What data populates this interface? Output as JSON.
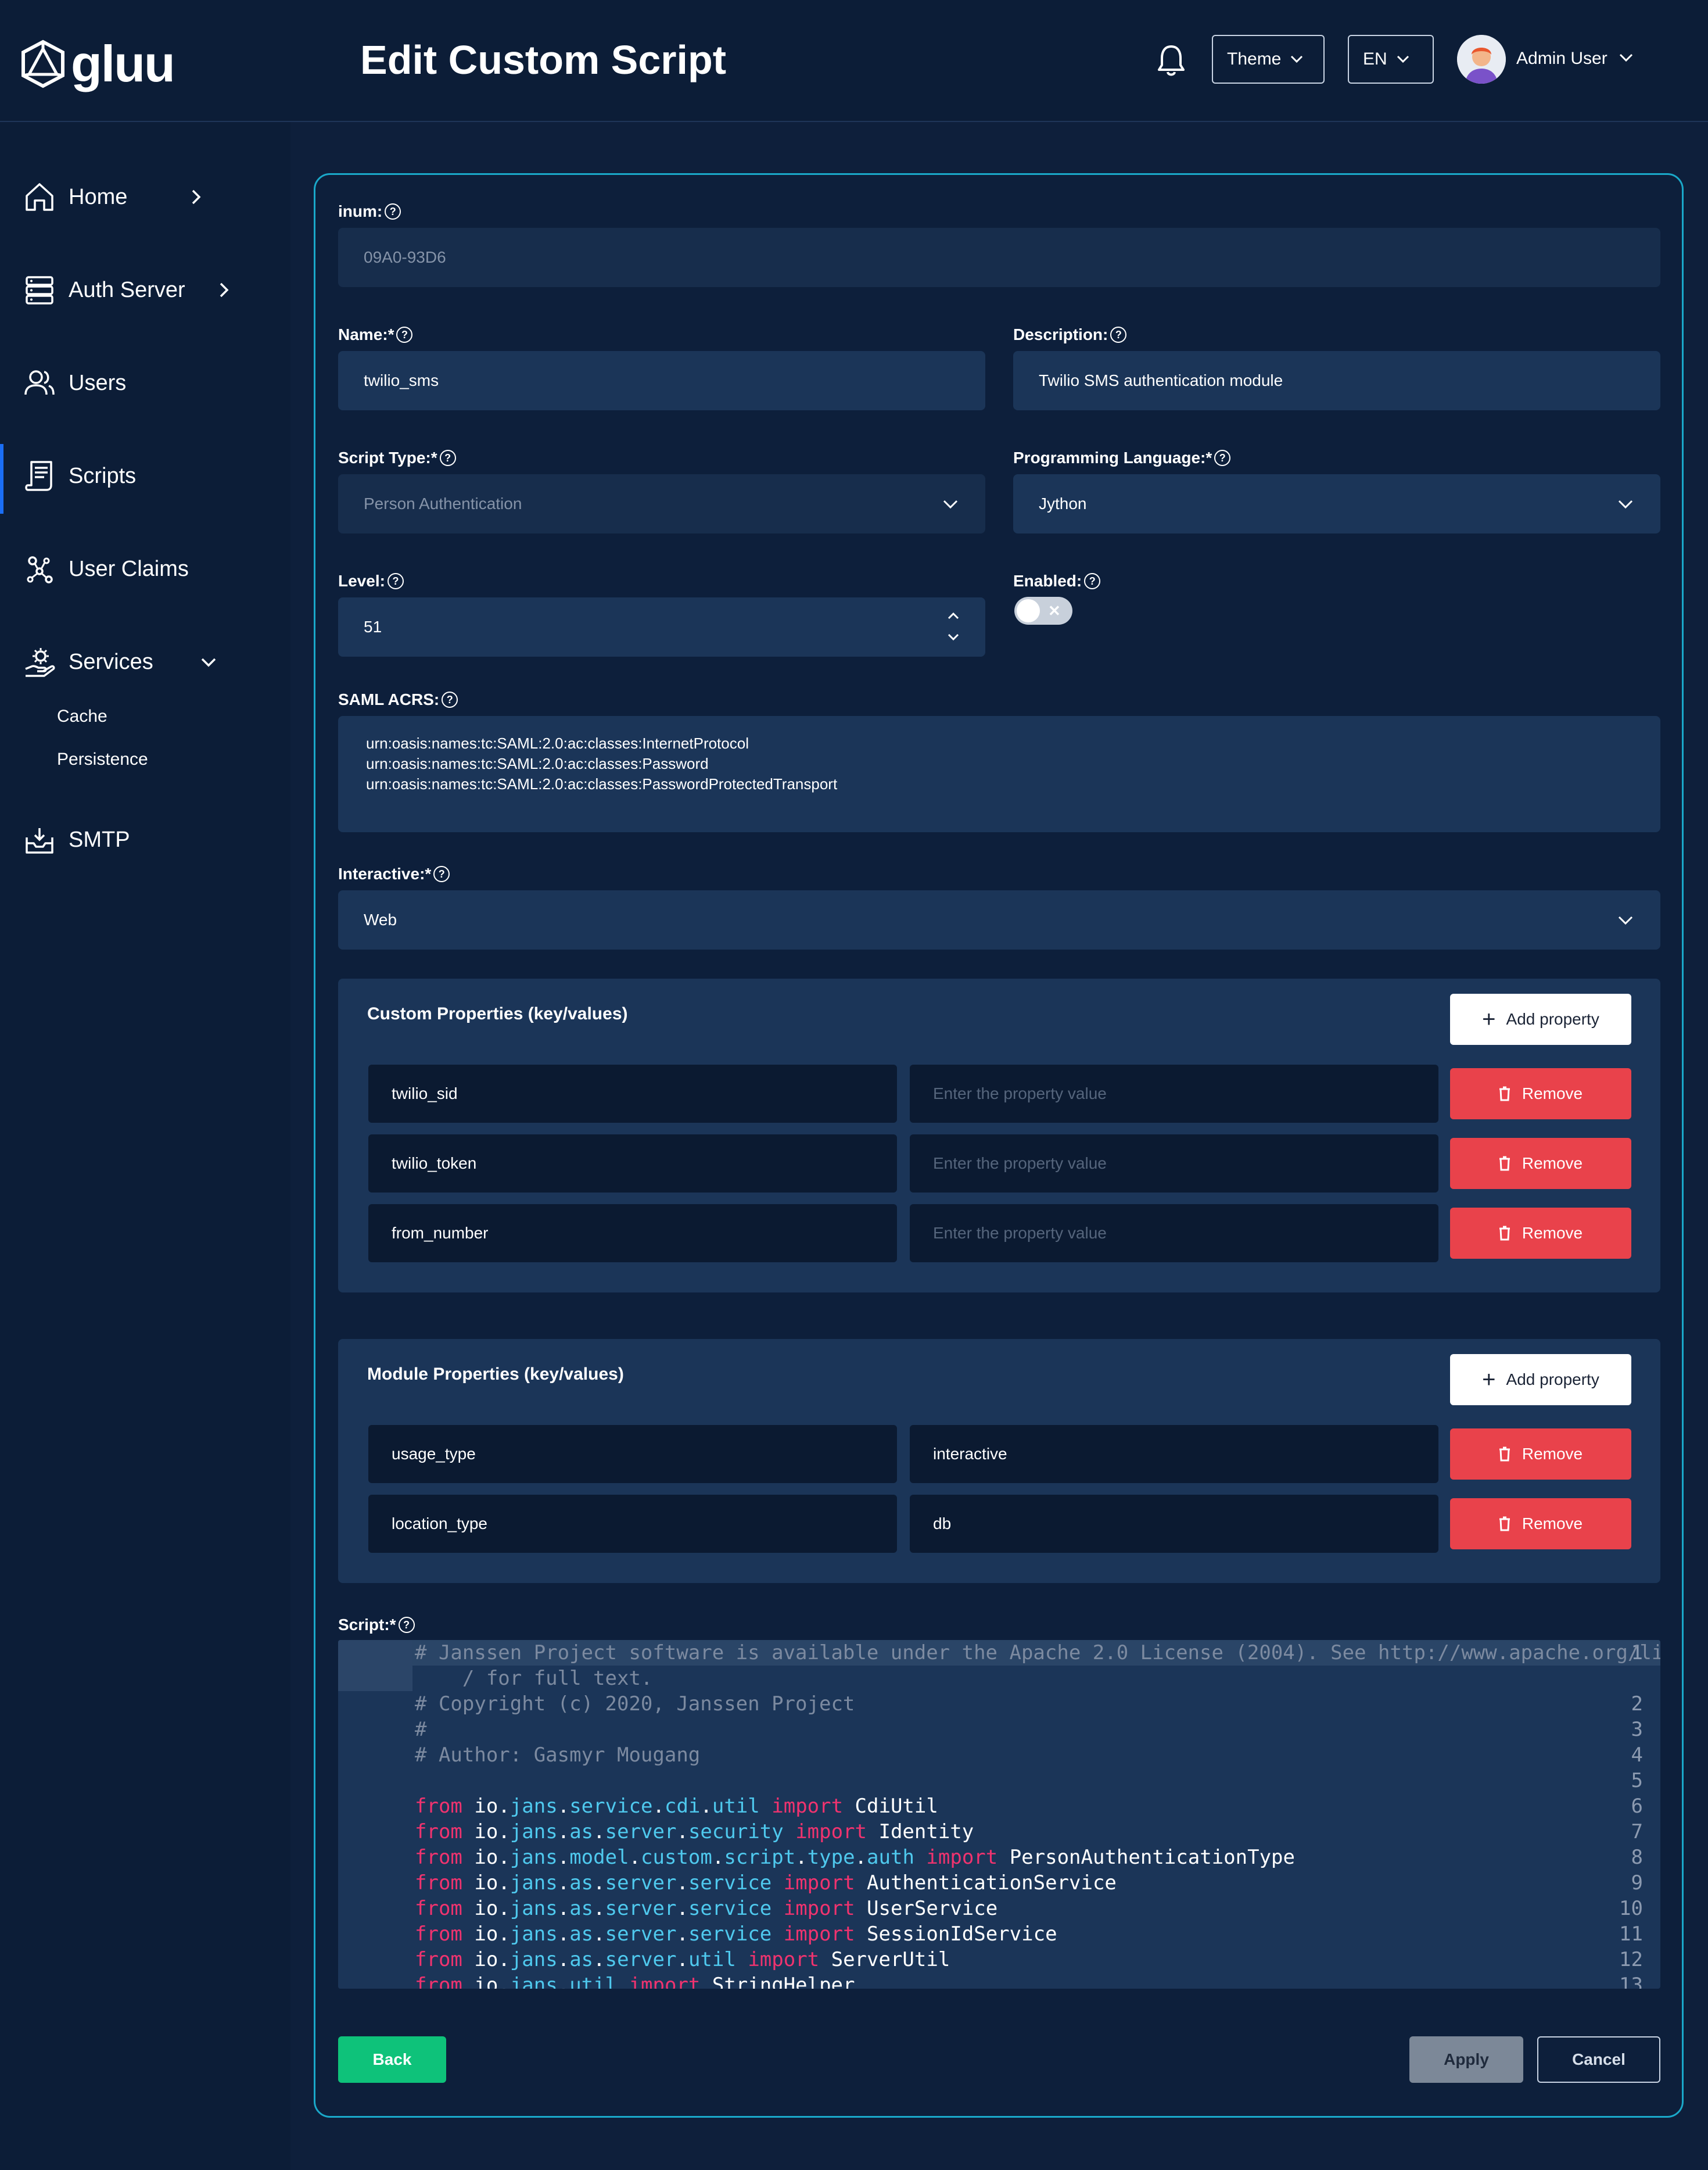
{
  "brand": {
    "name": "gluu"
  },
  "header": {
    "title": "Edit Custom Script",
    "theme_label": "Theme",
    "language_label": "EN",
    "user_name": "Admin User"
  },
  "sidebar": {
    "items": [
      {
        "label": "Home",
        "icon": "home-icon"
      },
      {
        "label": "Auth Server",
        "icon": "server-icon"
      },
      {
        "label": "Users",
        "icon": "users-icon"
      },
      {
        "label": "Scripts",
        "icon": "script-icon"
      },
      {
        "label": "User Claims",
        "icon": "claims-icon"
      },
      {
        "label": "Services",
        "icon": "services-icon",
        "subitems": [
          "Cache",
          "Persistence"
        ]
      },
      {
        "label": "SMTP",
        "icon": "mail-inbox-icon"
      }
    ]
  },
  "form": {
    "inum": {
      "label": "inum:",
      "value": "09A0-93D6"
    },
    "name": {
      "label": "Name:*",
      "value": "twilio_sms"
    },
    "description": {
      "label": "Description:",
      "value": "Twilio SMS authentication module"
    },
    "script_type": {
      "label": "Script Type:*",
      "value": "Person Authentication"
    },
    "programming_language": {
      "label": "Programming Language:*",
      "value": "Jython"
    },
    "level": {
      "label": "Level:",
      "value": "51"
    },
    "enabled": {
      "label": "Enabled:",
      "value": false
    },
    "saml_acrs": {
      "label": "SAML ACRS:",
      "values": [
        "urn:oasis:names:tc:SAML:2.0:ac:classes:InternetProtocol",
        "urn:oasis:names:tc:SAML:2.0:ac:classes:Password",
        "urn:oasis:names:tc:SAML:2.0:ac:classes:PasswordProtectedTransport"
      ]
    },
    "interactive": {
      "label": "Interactive:*",
      "value": "Web"
    }
  },
  "custom_properties": {
    "title": "Custom Properties (key/values)",
    "add_label": "Add property",
    "value_placeholder": "Enter the property value",
    "rows": [
      {
        "key": "twilio_sid",
        "value": ""
      },
      {
        "key": "twilio_token",
        "value": ""
      },
      {
        "key": "from_number",
        "value": ""
      }
    ],
    "remove_label": "Remove"
  },
  "module_properties": {
    "title": "Module Properties (key/values)",
    "add_label": "Add property",
    "rows": [
      {
        "key": "usage_type",
        "value": "interactive"
      },
      {
        "key": "location_type",
        "value": "db"
      }
    ],
    "remove_label": "Remove"
  },
  "script": {
    "label": "Script:*",
    "line_numbers": [
      "1",
      "2",
      "3",
      "4",
      "5",
      "6",
      "7",
      "8",
      "9",
      "10",
      "11",
      "12",
      "13"
    ],
    "lines": [
      "# Janssen Project software is available under the Apache 2.0 License (2004). See http://www.apache.org/licenses",
      "    / for full text.",
      "# Copyright (c) 2020, Janssen Project",
      "#",
      "# Author: Gasmyr Mougang",
      "",
      "from io.jans.service.cdi.util import CdiUtil",
      "from io.jans.as.server.security import Identity",
      "from io.jans.model.custom.script.type.auth import PersonAuthenticationType",
      "from io.jans.as.server.service import AuthenticationService",
      "from io.jans.as.server.service import UserService",
      "from io.jans.as.server.service import SessionIdService",
      "from io.jans.as.server.util import ServerUtil",
      "from io.jans.util import StringHelper"
    ]
  },
  "footer": {
    "back_label": "Back",
    "apply_label": "Apply",
    "cancel_label": "Cancel"
  },
  "colors": {
    "background": "#0e1f3b",
    "field": "#1b3558",
    "accent_border": "#1aa8c9",
    "remove": "#e9424b",
    "back": "#0ec27a"
  }
}
